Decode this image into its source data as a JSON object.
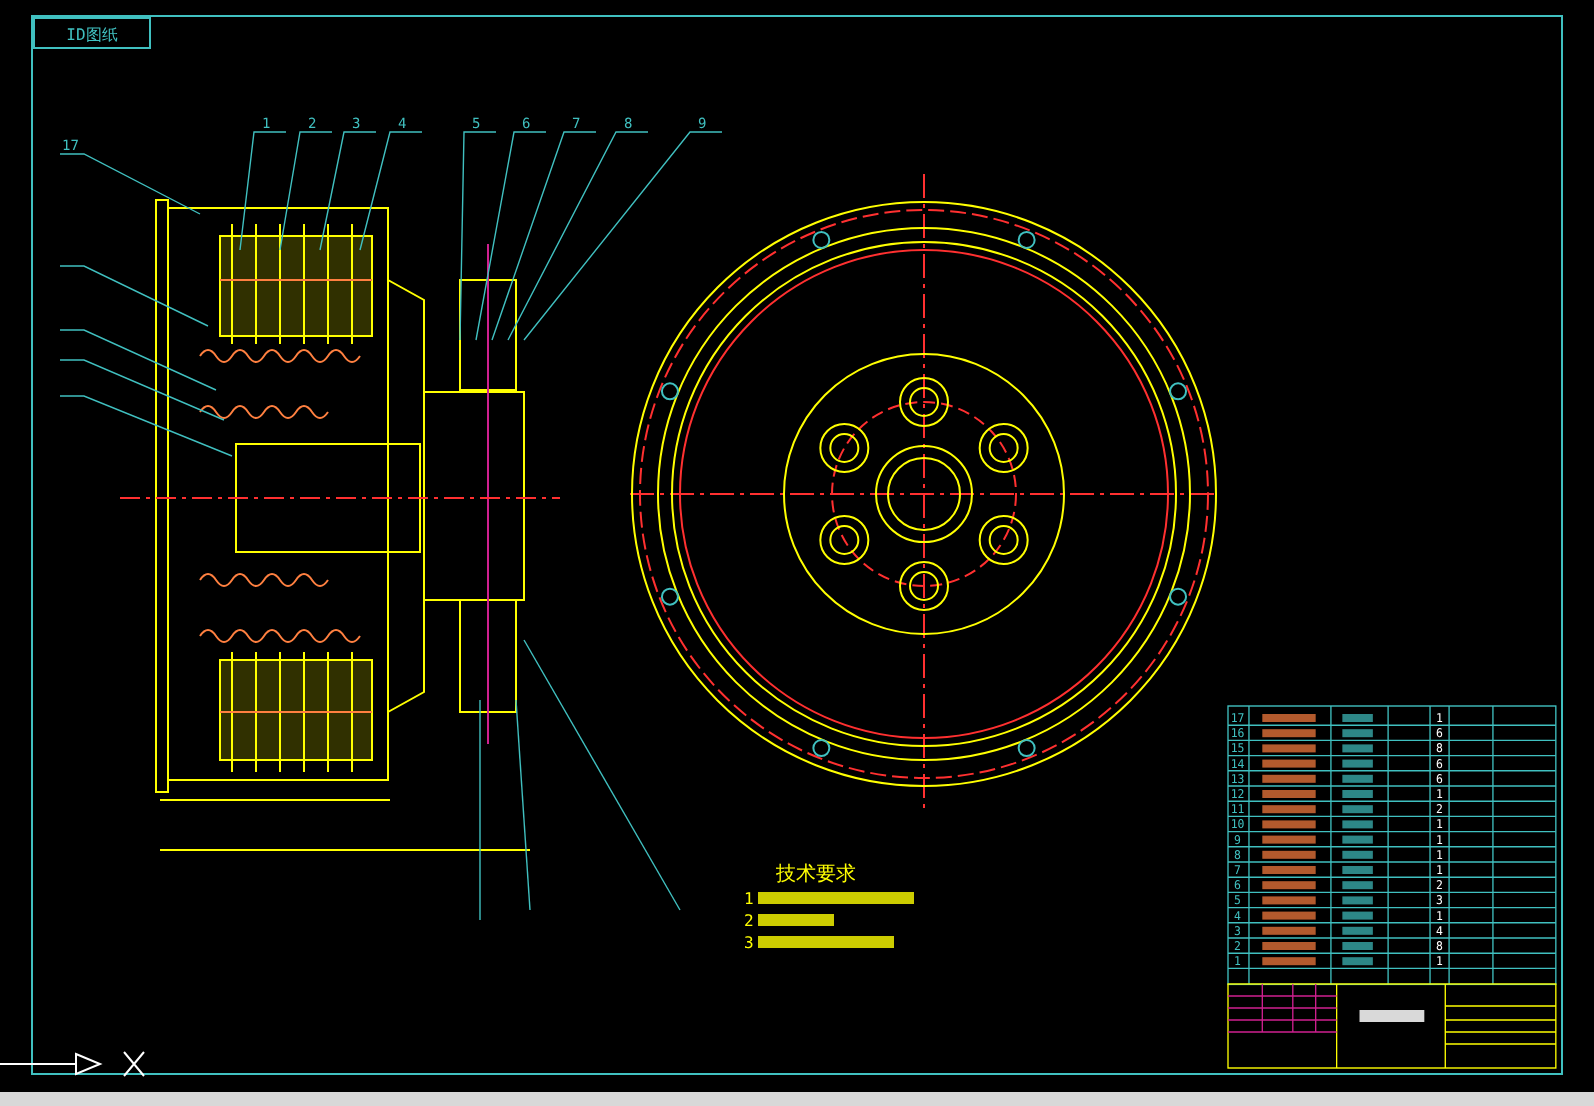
{
  "drawing_tab": {
    "label": "ID图纸"
  },
  "balloons": [
    {
      "label": "1"
    },
    {
      "label": "2"
    },
    {
      "label": "3"
    },
    {
      "label": "4"
    },
    {
      "label": "5"
    },
    {
      "label": "6"
    },
    {
      "label": "7"
    },
    {
      "label": "8"
    },
    {
      "label": "9"
    }
  ],
  "side_balloons": [
    {
      "label": "17"
    }
  ],
  "notes": {
    "title": "技术要求",
    "items": [
      "1",
      "2",
      "3"
    ]
  },
  "parts": [
    {
      "no": "17",
      "qty": "1"
    },
    {
      "no": "16",
      "qty": "6"
    },
    {
      "no": "15",
      "qty": "8"
    },
    {
      "no": "14",
      "qty": "6"
    },
    {
      "no": "13",
      "qty": "6"
    },
    {
      "no": "12",
      "qty": "1"
    },
    {
      "no": "11",
      "qty": "2"
    },
    {
      "no": "10",
      "qty": "1"
    },
    {
      "no": "9",
      "qty": "1"
    },
    {
      "no": "8",
      "qty": "1"
    },
    {
      "no": "7",
      "qty": "1"
    },
    {
      "no": "6",
      "qty": "2"
    },
    {
      "no": "5",
      "qty": "3"
    },
    {
      "no": "4",
      "qty": "1"
    },
    {
      "no": "3",
      "qty": "4"
    },
    {
      "no": "2",
      "qty": "8"
    },
    {
      "no": "1",
      "qty": "1"
    }
  ]
}
